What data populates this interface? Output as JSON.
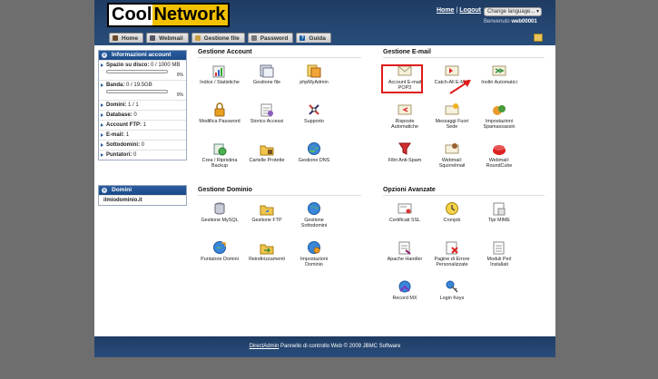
{
  "header": {
    "logo_part1": "Cool",
    "logo_part2": "Network",
    "home_link": "Home",
    "separator": "|",
    "logout_link": "Logout",
    "language_select": "Change language...",
    "welcome_prefix": "Benvenuto",
    "username": "web00001"
  },
  "tabs": [
    {
      "label": "Home",
      "icon": "home-icon"
    },
    {
      "label": "Webmail",
      "icon": "mail-icon"
    },
    {
      "label": "Gestione file",
      "icon": "folder-icon"
    },
    {
      "label": "Password",
      "icon": "key-icon"
    },
    {
      "label": "Guida",
      "icon": "help-icon"
    }
  ],
  "account_info": {
    "title": "Informazioni account",
    "disk_label": "Spazio su disco:",
    "disk_value": "0 / 1000 MB",
    "disk_pct": "0%",
    "disk_fraction": 0,
    "bandwidth_label": "Banda:",
    "bandwidth_value": "0 / 19.5GB",
    "bandwidth_pct": "0%",
    "bandwidth_fraction": 0,
    "rows": [
      {
        "label": "Domini:",
        "value": "1 / 1"
      },
      {
        "label": "Database:",
        "value": "0"
      },
      {
        "label": "Account FTP:",
        "value": "1"
      },
      {
        "label": "E-mail:",
        "value": "1"
      },
      {
        "label": "Sottodomini:",
        "value": "0"
      },
      {
        "label": "Puntatori:",
        "value": "0"
      }
    ]
  },
  "domains_box": {
    "title": "Domini",
    "domain": "ilmiodominio.it"
  },
  "gestione_account": {
    "title": "Gestione Account",
    "items": [
      {
        "label": "Indice / Statistiche",
        "icon": "statistics-icon"
      },
      {
        "label": "Gestione file",
        "icon": "file-manager-icon"
      },
      {
        "label": "phpMyAdmin",
        "icon": "phpmyadmin-icon"
      },
      {
        "label": "Modifica Password",
        "icon": "lock-icon"
      },
      {
        "label": "Storico Accessi",
        "icon": "access-log-icon"
      },
      {
        "label": "Supporto",
        "icon": "support-icon"
      },
      {
        "label": "Crea / Ripristina Backup",
        "icon": "backup-icon"
      },
      {
        "label": "Cartelle Protette",
        "icon": "protected-folder-icon"
      },
      {
        "label": "Gestione DNS",
        "icon": "dns-icon"
      }
    ]
  },
  "gestione_email": {
    "title": "Gestione E-mail",
    "items": [
      {
        "label": "Account E-mail POP3",
        "icon": "envelope-icon"
      },
      {
        "label": "Catch-All E-Mail",
        "icon": "catch-all-icon"
      },
      {
        "label": "Inoltri Automatici",
        "icon": "forwarder-icon"
      },
      {
        "label": "Risposte Automatiche",
        "icon": "autoresponder-icon"
      },
      {
        "label": "Messaggi Fuori Sede",
        "icon": "vacation-icon"
      },
      {
        "label": "Impostazioni Spamassassin",
        "icon": "spamassassin-icon"
      },
      {
        "label": "Filtri Anti-Spam",
        "icon": "spam-filter-icon"
      },
      {
        "label": "Webmail: Squirrelmail",
        "icon": "squirrelmail-icon"
      },
      {
        "label": "Webmail: RoundCube",
        "icon": "roundcube-icon"
      }
    ]
  },
  "gestione_dominio": {
    "title": "Gestione Dominio",
    "items": [
      {
        "label": "Gestione MySQL",
        "icon": "mysql-icon"
      },
      {
        "label": "Gestione FTP",
        "icon": "ftp-icon"
      },
      {
        "label": "Gestione Sottodomini",
        "icon": "subdomain-icon"
      },
      {
        "label": "Puntatore Domini",
        "icon": "domain-pointer-icon"
      },
      {
        "label": "Reindirizzamenti",
        "icon": "redirect-icon"
      },
      {
        "label": "Impostazioni Dominio",
        "icon": "domain-settings-icon"
      }
    ]
  },
  "opzioni_avanzate": {
    "title": "Opzioni Avanzate",
    "items": [
      {
        "label": "Certificati SSL",
        "icon": "ssl-certificate-icon"
      },
      {
        "label": "Cronjob",
        "icon": "cronjob-icon"
      },
      {
        "label": "Tipi MIME",
        "icon": "mime-icon"
      },
      {
        "label": "Apache Handler",
        "icon": "apache-handler-icon"
      },
      {
        "label": "Pagine di Errore Personalizzate",
        "icon": "error-pages-icon"
      },
      {
        "label": "Moduli Perl Installati",
        "icon": "perl-modules-icon"
      },
      {
        "label": "Record MX",
        "icon": "mx-record-icon"
      },
      {
        "label": "Login Keys",
        "icon": "login-keys-icon"
      }
    ]
  },
  "footer": {
    "link": "DirectAdmin",
    "text": " Pannello di controllo Web © 2009 JBMC Software"
  },
  "colors": {
    "header_bg": "#1f3c63",
    "logo_accent": "#f2c200",
    "highlight": "#e01b1b",
    "page_bg": "#6e6e6e"
  }
}
